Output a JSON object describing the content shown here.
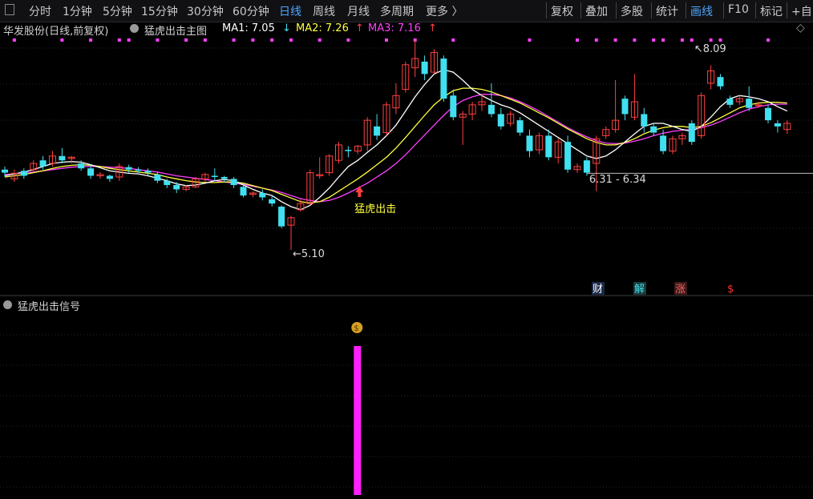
{
  "toolbar": {
    "periods": [
      "分时",
      "1分钟",
      "5分钟",
      "15分钟",
      "30分钟",
      "60分钟",
      "日线",
      "周线",
      "月线",
      "多周期",
      "更多 〉"
    ],
    "active_period": "日线",
    "right_items": [
      "复权",
      "叠加",
      "多股",
      "统计",
      "画线",
      "F10",
      "标记",
      "+自"
    ],
    "active_right": "画线"
  },
  "info": {
    "stock": "华发股份(日线,前复权)",
    "indicator": "猛虎出击主图",
    "ma1_label": "MA1: 7.05",
    "ma1_arrow": "↓",
    "ma2_label": "MA2: 7.26",
    "ma2_arrow": "↑",
    "ma3_label": "MA3: 7.16",
    "ma3_arrow": "↑"
  },
  "lower": {
    "title": "猛虎出击信号"
  },
  "annotations": {
    "low": "5.10",
    "high": "8.09",
    "range": "6.31 - 6.34",
    "signal_text": "猛虎出击",
    "badge_cai": "财",
    "badge_jie": "解",
    "badge_zhang": "涨",
    "badge_dollar": "$"
  },
  "colors": {
    "up": "#ff4040",
    "down": "#40e0f0",
    "ma1": "#ffffff",
    "ma2": "#ffff40",
    "ma3": "#ff40ff",
    "signal_bar": "#ff20ff",
    "dots": "#ff40ff",
    "active": "#4ea8ff"
  },
  "chart_data": {
    "type": "candlestick",
    "price_range": [
      4.8,
      8.5
    ],
    "candles": [
      [
        6.35,
        6.4,
        6.28,
        6.45,
        "down"
      ],
      [
        6.25,
        6.34,
        6.2,
        6.4,
        "up"
      ],
      [
        6.38,
        6.3,
        6.25,
        6.42,
        "down"
      ],
      [
        6.4,
        6.5,
        6.35,
        6.55,
        "up"
      ],
      [
        6.55,
        6.45,
        6.4,
        6.62,
        "down"
      ],
      [
        6.5,
        6.62,
        6.45,
        6.7,
        "up"
      ],
      [
        6.62,
        6.55,
        6.5,
        6.75,
        "down"
      ],
      [
        6.58,
        6.6,
        6.5,
        6.62,
        "up"
      ],
      [
        6.5,
        6.42,
        6.38,
        6.55,
        "down"
      ],
      [
        6.42,
        6.3,
        6.25,
        6.48,
        "down"
      ],
      [
        6.3,
        6.32,
        6.25,
        6.36,
        "up"
      ],
      [
        6.3,
        6.25,
        6.2,
        6.32,
        "down"
      ],
      [
        6.28,
        6.45,
        6.22,
        6.5,
        "up"
      ],
      [
        6.44,
        6.4,
        6.35,
        6.48,
        "down"
      ],
      [
        6.4,
        6.38,
        6.35,
        6.44,
        "down"
      ],
      [
        6.38,
        6.35,
        6.3,
        6.42,
        "down"
      ],
      [
        6.32,
        6.22,
        6.18,
        6.36,
        "down"
      ],
      [
        6.22,
        6.15,
        6.1,
        6.25,
        "down"
      ],
      [
        6.15,
        6.08,
        6.02,
        6.2,
        "down"
      ],
      [
        6.08,
        6.12,
        6.05,
        6.15,
        "up"
      ],
      [
        6.12,
        6.25,
        6.1,
        6.28,
        "up"
      ],
      [
        6.25,
        6.32,
        6.2,
        6.35,
        "up"
      ],
      [
        6.3,
        6.28,
        6.22,
        6.42,
        "down"
      ],
      [
        6.28,
        6.25,
        6.2,
        6.3,
        "down"
      ],
      [
        6.25,
        6.15,
        6.1,
        6.28,
        "down"
      ],
      [
        6.12,
        5.98,
        5.95,
        6.15,
        "down"
      ],
      [
        6.0,
        6.02,
        5.95,
        6.05,
        "up"
      ],
      [
        6.02,
        5.95,
        5.9,
        6.08,
        "down"
      ],
      [
        5.92,
        5.85,
        5.8,
        5.98,
        "down"
      ],
      [
        5.8,
        5.48,
        5.45,
        5.82,
        "down"
      ],
      [
        5.5,
        5.62,
        5.1,
        5.65,
        "up"
      ],
      [
        5.75,
        5.85,
        5.72,
        5.92,
        "up"
      ],
      [
        5.85,
        6.35,
        5.82,
        6.4,
        "up"
      ],
      [
        6.3,
        6.32,
        6.25,
        6.6,
        "up"
      ],
      [
        6.35,
        6.62,
        6.3,
        6.65,
        "up"
      ],
      [
        6.55,
        6.8,
        6.5,
        6.85,
        "up"
      ],
      [
        6.72,
        6.7,
        6.6,
        6.78,
        "down"
      ],
      [
        6.7,
        6.78,
        6.65,
        6.8,
        "up"
      ],
      [
        6.8,
        7.2,
        6.7,
        7.25,
        "up"
      ],
      [
        7.1,
        6.95,
        6.88,
        7.3,
        "down"
      ],
      [
        7.0,
        7.45,
        6.95,
        7.5,
        "up"
      ],
      [
        7.4,
        7.6,
        7.3,
        7.8,
        "up"
      ],
      [
        7.7,
        8.1,
        7.65,
        8.15,
        "up"
      ],
      [
        8.05,
        8.2,
        7.9,
        8.5,
        "up"
      ],
      [
        8.15,
        7.95,
        7.85,
        8.25,
        "down"
      ],
      [
        7.98,
        8.3,
        7.95,
        8.35,
        "up"
      ],
      [
        8.2,
        7.55,
        7.5,
        8.25,
        "down"
      ],
      [
        7.6,
        7.25,
        7.2,
        7.7,
        "down"
      ],
      [
        7.25,
        7.3,
        6.8,
        7.35,
        "up"
      ],
      [
        7.3,
        7.45,
        7.2,
        7.5,
        "up"
      ],
      [
        7.45,
        7.5,
        7.35,
        7.62,
        "up"
      ],
      [
        7.45,
        7.3,
        7.25,
        7.8,
        "down"
      ],
      [
        7.3,
        7.1,
        7.05,
        7.4,
        "down"
      ],
      [
        7.15,
        7.3,
        7.1,
        7.35,
        "up"
      ],
      [
        7.2,
        7.0,
        6.95,
        7.25,
        "down"
      ],
      [
        6.95,
        6.7,
        6.6,
        7.05,
        "down"
      ],
      [
        6.72,
        6.95,
        6.65,
        7.0,
        "up"
      ],
      [
        6.95,
        6.6,
        6.55,
        7.05,
        "down"
      ],
      [
        6.6,
        6.85,
        6.5,
        6.9,
        "up"
      ],
      [
        6.85,
        6.4,
        6.35,
        6.95,
        "down"
      ],
      [
        6.4,
        6.45,
        6.35,
        6.5,
        "up"
      ],
      [
        6.55,
        6.35,
        6.3,
        6.6,
        "down"
      ],
      [
        6.5,
        6.9,
        6.05,
        6.95,
        "up"
      ],
      [
        6.95,
        7.05,
        6.9,
        7.1,
        "up"
      ],
      [
        7.05,
        7.2,
        7.0,
        7.85,
        "up"
      ],
      [
        7.55,
        7.3,
        7.2,
        7.6,
        "down"
      ],
      [
        7.25,
        7.5,
        7.2,
        7.95,
        "up"
      ],
      [
        7.3,
        7.1,
        7.0,
        7.4,
        "down"
      ],
      [
        7.1,
        7.0,
        6.95,
        7.15,
        "down"
      ],
      [
        6.95,
        6.7,
        6.65,
        7.05,
        "down"
      ],
      [
        6.7,
        6.9,
        6.65,
        6.95,
        "up"
      ],
      [
        6.9,
        6.95,
        6.8,
        7.0,
        "up"
      ],
      [
        7.15,
        6.85,
        6.8,
        7.2,
        "down"
      ],
      [
        6.95,
        7.6,
        6.9,
        7.65,
        "up"
      ],
      [
        7.8,
        8.0,
        7.7,
        8.09,
        "up"
      ],
      [
        7.9,
        7.75,
        7.7,
        7.95,
        "down"
      ],
      [
        7.55,
        7.45,
        7.4,
        7.6,
        "down"
      ],
      [
        7.5,
        7.55,
        7.45,
        7.6,
        "up"
      ],
      [
        7.55,
        7.4,
        7.35,
        7.75,
        "down"
      ],
      [
        7.45,
        7.45,
        7.4,
        7.5,
        "up"
      ],
      [
        7.4,
        7.2,
        7.15,
        7.45,
        "down"
      ],
      [
        7.15,
        7.1,
        7.0,
        7.2,
        "down"
      ],
      [
        7.15,
        7.05,
        6.98,
        7.2,
        "up"
      ]
    ],
    "ma1": [
      6.3,
      6.33,
      6.36,
      6.4,
      6.45,
      6.5,
      6.52,
      6.53,
      6.52,
      6.48,
      6.43,
      6.38,
      6.36,
      6.34,
      6.33,
      6.3,
      6.26,
      6.22,
      6.17,
      6.14,
      6.15,
      6.18,
      6.22,
      6.24,
      6.22,
      6.15,
      6.08,
      6.02,
      5.98,
      5.88,
      5.8,
      5.75,
      5.82,
      5.95,
      6.1,
      6.28,
      6.45,
      6.55,
      6.68,
      6.8,
      6.95,
      7.12,
      7.35,
      7.58,
      7.78,
      7.95,
      8.02,
      7.98,
      7.85,
      7.7,
      7.6,
      7.52,
      7.45,
      7.4,
      7.32,
      7.22,
      7.12,
      7.02,
      6.92,
      6.82,
      6.72,
      6.62,
      6.58,
      6.62,
      6.72,
      6.85,
      6.98,
      7.1,
      7.15,
      7.15,
      7.1,
      7.05,
      7.02,
      7.1,
      7.25,
      7.42,
      7.55,
      7.6,
      7.58,
      7.55,
      7.5,
      7.42,
      7.35
    ],
    "ma2": [
      6.28,
      6.3,
      6.32,
      6.35,
      6.38,
      6.42,
      6.45,
      6.47,
      6.48,
      6.47,
      6.45,
      6.42,
      6.4,
      6.38,
      6.36,
      6.34,
      6.32,
      6.28,
      6.25,
      6.22,
      6.2,
      6.19,
      6.19,
      6.2,
      6.2,
      6.18,
      6.14,
      6.1,
      6.06,
      6.0,
      5.94,
      5.88,
      5.86,
      5.88,
      5.95,
      6.05,
      6.15,
      6.25,
      6.36,
      6.48,
      6.6,
      6.75,
      6.92,
      7.1,
      7.28,
      7.45,
      7.58,
      7.68,
      7.72,
      7.72,
      7.7,
      7.66,
      7.6,
      7.54,
      7.48,
      7.4,
      7.32,
      7.24,
      7.15,
      7.06,
      6.98,
      6.9,
      6.84,
      6.8,
      6.8,
      6.84,
      6.9,
      6.98,
      7.04,
      7.08,
      7.1,
      7.1,
      7.08,
      7.1,
      7.16,
      7.24,
      7.32,
      7.4,
      7.45,
      7.48,
      7.49,
      7.49,
      7.48
    ],
    "ma3": [
      6.32,
      6.33,
      6.35,
      6.36,
      6.38,
      6.4,
      6.42,
      6.44,
      6.45,
      6.45,
      6.45,
      6.44,
      6.43,
      6.42,
      6.4,
      6.38,
      6.36,
      6.33,
      6.3,
      6.28,
      6.26,
      6.24,
      6.22,
      6.2,
      6.18,
      6.16,
      6.13,
      6.1,
      6.07,
      6.03,
      5.98,
      5.93,
      5.9,
      5.88,
      5.9,
      5.95,
      6.02,
      6.1,
      6.18,
      6.28,
      6.38,
      6.5,
      6.64,
      6.8,
      6.96,
      7.12,
      7.28,
      7.42,
      7.52,
      7.58,
      7.62,
      7.62,
      7.6,
      7.56,
      7.5,
      7.43,
      7.35,
      7.26,
      7.17,
      7.08,
      7.0,
      6.93,
      6.87,
      6.83,
      6.82,
      6.83,
      6.86,
      6.9,
      6.95,
      6.99,
      7.02,
      7.04,
      7.05,
      7.08,
      7.12,
      7.18,
      7.25,
      7.32,
      7.38,
      7.42,
      7.45,
      7.46,
      7.46
    ],
    "signal": {
      "index": 37,
      "label": "猛虎出击"
    },
    "support_line": 6.34,
    "low_point": 5.1,
    "high_point": 8.09
  }
}
